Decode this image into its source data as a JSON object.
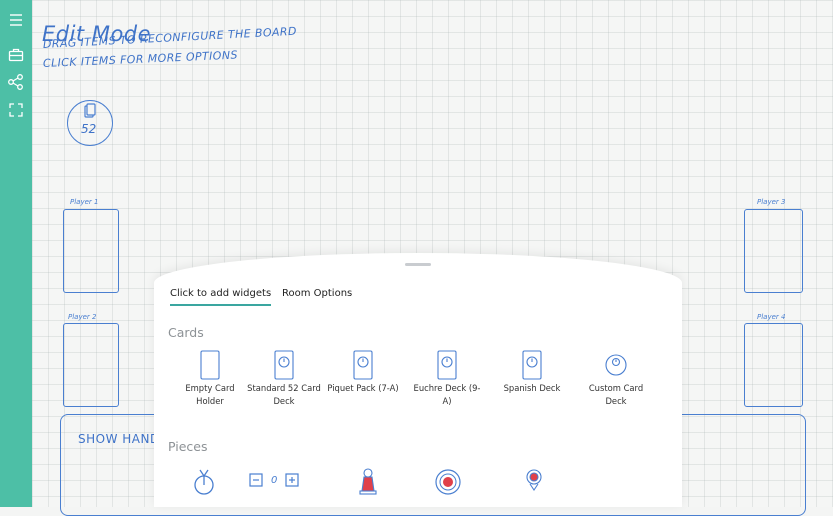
{
  "sidebar": {
    "items": [
      {
        "icon": "menu-icon"
      },
      {
        "icon": "briefcase-icon"
      },
      {
        "icon": "share-icon"
      },
      {
        "icon": "fullscreen-icon"
      }
    ]
  },
  "board": {
    "title": "Edit Mode",
    "subtitle_line1": "Drag items to reconfigure the board",
    "subtitle_line2": "Click items for more options",
    "deck_count": "52",
    "players": [
      {
        "label": "Player 1"
      },
      {
        "label": "Player 2"
      },
      {
        "label": "Player 3"
      },
      {
        "label": "Player 4"
      }
    ],
    "show_hand_label": "Show Hand"
  },
  "panel": {
    "tabs": [
      {
        "label": "Click to add widgets",
        "active": true
      },
      {
        "label": "Room Options",
        "active": false
      }
    ],
    "cards_section": "Cards",
    "card_widgets": [
      {
        "label": "Empty Card Holder",
        "icon": "empty-card-icon"
      },
      {
        "label": "Standard 52 Card Deck",
        "icon": "deck-icon"
      },
      {
        "label": "Piquet Pack (7-A)",
        "icon": "deck-icon"
      },
      {
        "label": "Euchre Deck (9-A)",
        "icon": "deck-icon"
      },
      {
        "label": "Spanish Deck",
        "icon": "deck-icon"
      },
      {
        "label": "Custom Card Deck",
        "icon": "custom-deck-icon"
      }
    ],
    "pieces_section": "Pieces",
    "counter_value": "0",
    "colors": {
      "accent": "#4dbfa6",
      "ink": "#4a7fd0",
      "red": "#e0404a"
    }
  }
}
